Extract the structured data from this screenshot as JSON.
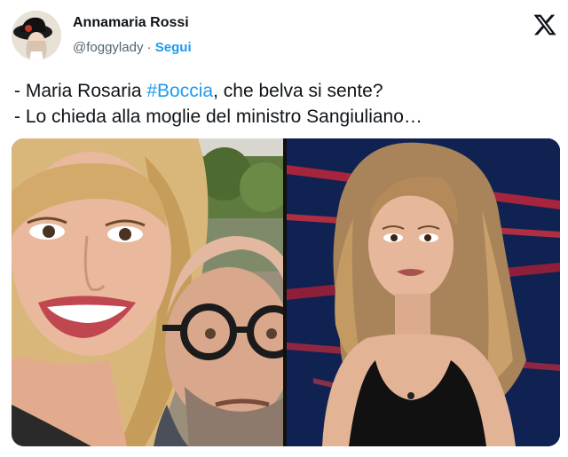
{
  "author": {
    "display_name": "Annamaria Rossi",
    "handle": "@foggylady",
    "separator": " · ",
    "follow_label": "Segui"
  },
  "tweet": {
    "line1_prefix": "- Maria Rosaria ",
    "line1_hashtag": "#Boccia",
    "line1_suffix": ", che belva si sente?",
    "line2": "- Lo chieda alla moglie del ministro Sangiuliano…"
  },
  "icons": {
    "platform": "x-logo-icon",
    "avatar": "profile-avatar"
  },
  "colors": {
    "link": "#1d9bf0",
    "text": "#0f1419",
    "secondary": "#536471"
  }
}
